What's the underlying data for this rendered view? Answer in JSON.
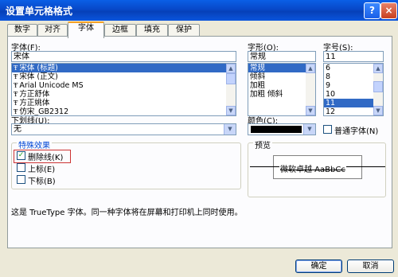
{
  "window": {
    "title": "设置单元格格式",
    "help": "?",
    "close": "×"
  },
  "tabs": [
    "数字",
    "对齐",
    "字体",
    "边框",
    "填充",
    "保护"
  ],
  "font": {
    "label": "字体(F):",
    "value": "宋体",
    "items": [
      "宋体 (标题)",
      "宋体 (正文)",
      "Arial Unicode MS",
      "方正舒体",
      "方正姚体",
      "仿宋_GB2312"
    ],
    "selected_index": 0
  },
  "style": {
    "label": "字形(O):",
    "value": "常规",
    "items": [
      "常规",
      "倾斜",
      "加粗",
      "加粗 倾斜"
    ],
    "selected_index": 0
  },
  "size": {
    "label": "字号(S):",
    "value": "11",
    "items": [
      "6",
      "8",
      "9",
      "10",
      "11",
      "12"
    ],
    "selected_index": 4
  },
  "underline": {
    "label": "下划线(U):",
    "value": "无"
  },
  "color": {
    "label": "颜色(C):",
    "swatch": "#000000"
  },
  "normal_font": {
    "label": "普通字体(N)",
    "checked": false
  },
  "effects": {
    "title": "特殊效果",
    "strikethrough": {
      "label": "删除线(K)",
      "checked": true
    },
    "superscript": {
      "label": "上标(E)",
      "checked": false
    },
    "subscript": {
      "label": "下标(B)",
      "checked": false
    }
  },
  "preview": {
    "title": "预览",
    "sample": "微软卓越  AaBbCc"
  },
  "info": "这是 TrueType 字体。同一种字体将在屏幕和打印机上同时使用。",
  "buttons": {
    "ok": "确定",
    "cancel": "取消"
  },
  "colors": {
    "titlebar": "#0848c8",
    "selection": "#316ac5",
    "highlight_box": "#cc3333"
  }
}
